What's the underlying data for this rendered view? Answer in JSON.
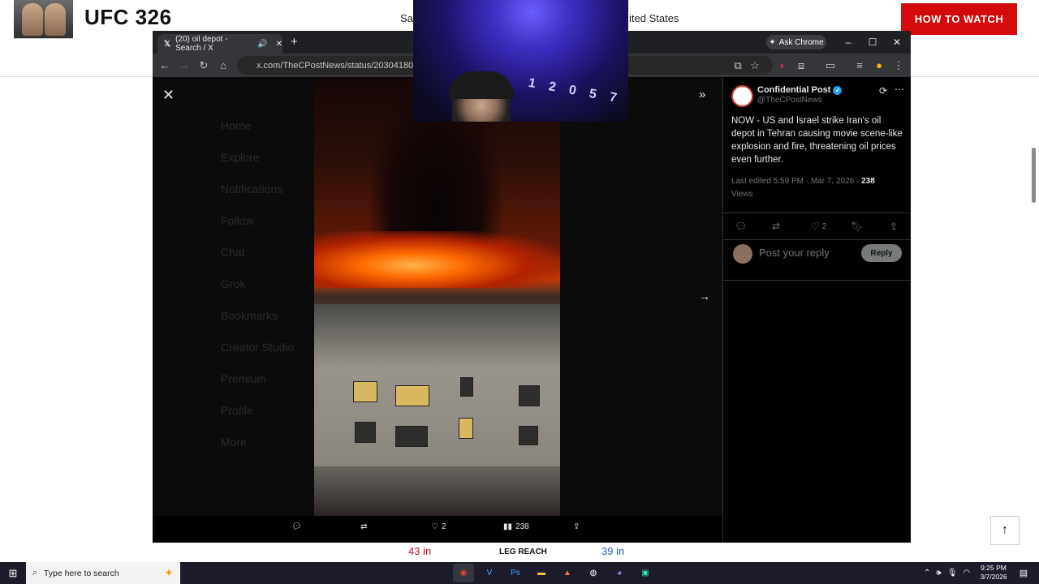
{
  "background_page": {
    "title": "UFC 326",
    "date_text": "Sat",
    "location_text": "ited States",
    "how_to_watch": "HOW TO WATCH",
    "reach_left": "43 in",
    "reach_label": "LEG REACH",
    "reach_right": "39 in"
  },
  "browser": {
    "tab_title": "(20) oil depot - Search / X",
    "ask_chrome": "Ask Chrome",
    "url": "x.com/TheCPostNews/status/20304180110567"
  },
  "media_viewer": {
    "reply_count": "",
    "like_count": "2",
    "views_count": "238"
  },
  "tweet": {
    "author": "Confidential Post",
    "handle": "@TheCPostNews",
    "text": "NOW - US and Israel strike Iran's oil depot in Tehran causing movie scene-like explosion and fire, threatening oil prices even further.",
    "edited": "Last edited 5:59 PM · Mar 7, 2026 · ",
    "views": "238",
    "views_label": "Views",
    "likes": "2",
    "reply_placeholder": "Post your reply",
    "reply_button": "Reply"
  },
  "sidebar_dim": [
    "Home",
    "Explore",
    "Notifications",
    "Follow",
    "Chat",
    "Grok",
    "Bookmarks",
    "Creator Studio",
    "Premium",
    "Profile",
    "More"
  ],
  "webcam": {
    "overlay_text": "1 2 0 5 7"
  },
  "taskbar": {
    "search_placeholder": "Type here to search",
    "time": "9:25 PM",
    "date": "3/7/2026"
  },
  "colors": {
    "brand_red": "#d20a0a",
    "x_blue": "#1d9bf0"
  }
}
